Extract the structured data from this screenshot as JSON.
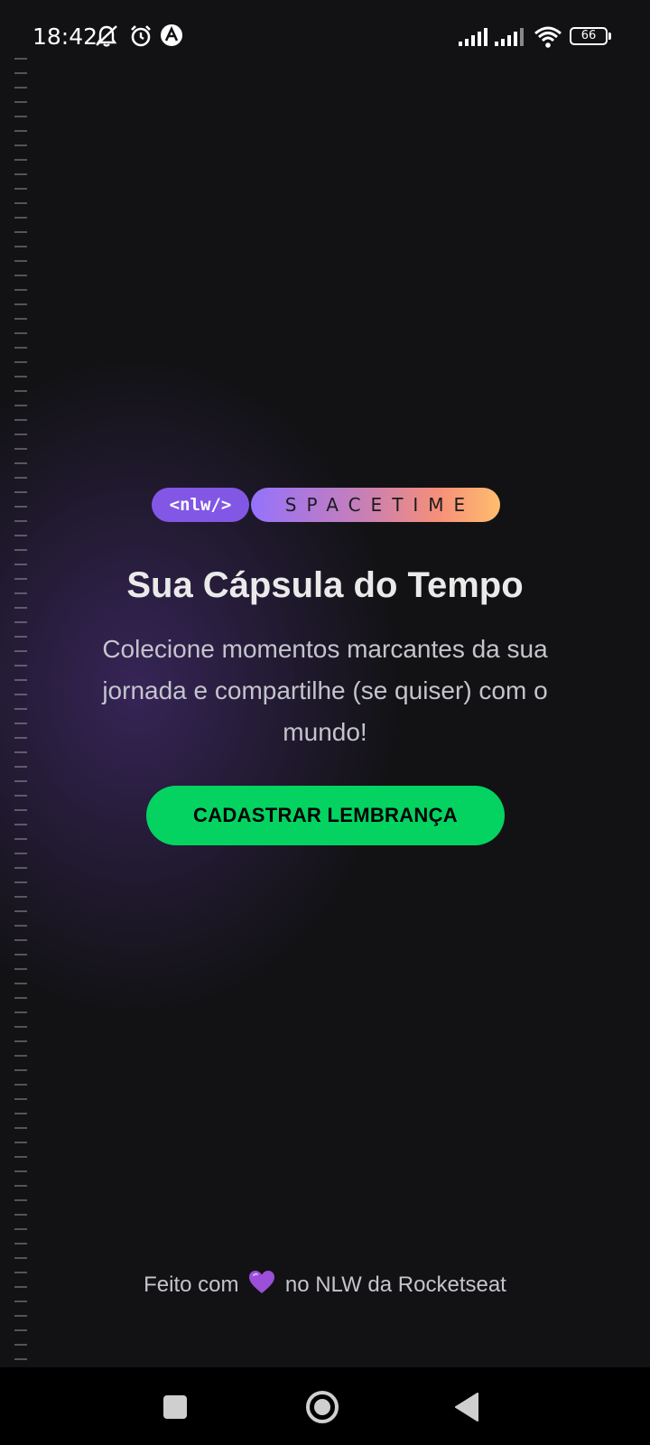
{
  "status_bar": {
    "time": "18:42",
    "battery_level": "66",
    "icons": [
      "mute-icon",
      "alarm-icon",
      "app-notification-icon",
      "signal-icon",
      "signal-icon",
      "wifi-icon",
      "battery-icon"
    ]
  },
  "logo": {
    "tag": "<nlw/>",
    "name": "SPACETIME"
  },
  "hero": {
    "title": "Sua Cápsula do Tempo",
    "subtitle": "Colecione momentos marcantes da sua jornada e compartilhe (se quiser) com o mundo!"
  },
  "cta": {
    "label": "CADASTRAR LEMBRANÇA"
  },
  "footer": {
    "prefix": "Feito com",
    "suffix": "no NLW da Rocketseat"
  },
  "nav_bar": {
    "buttons": [
      "recents-icon",
      "home-icon",
      "back-icon"
    ]
  },
  "colors": {
    "background": "#121214",
    "accent_green": "#04d361",
    "accent_purple": "#8257e5",
    "text_light": "#eaeaea",
    "text_muted": "#c4c4cc"
  }
}
